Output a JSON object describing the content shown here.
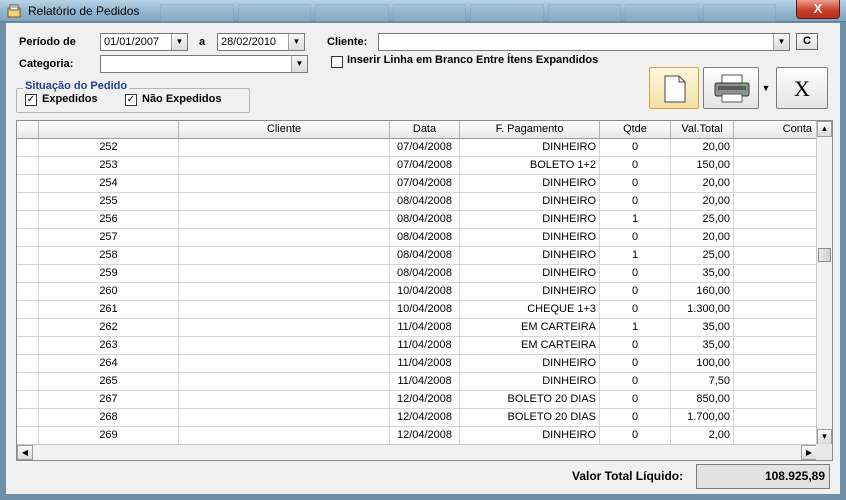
{
  "window": {
    "title": "Relatório de Pedidos",
    "close_label": "X"
  },
  "filters": {
    "periodo_label": "Período de",
    "date_from": "01/01/2007",
    "date_sep": "a",
    "date_to": "28/02/2010",
    "cliente_label": "Cliente:",
    "cliente_value": "",
    "clear_label": "C",
    "categoria_label": "Categoria:",
    "categoria_value": "",
    "blank_line_label": "Inserir Linha em Branco Entre Ítens Expandidos",
    "blank_line_checked": false
  },
  "situacao": {
    "title": "Situação do Pedido",
    "expedidos_label": "Expedidos",
    "expedidos_checked": true,
    "nao_expedidos_label": "Não Expedidos",
    "nao_expedidos_checked": true
  },
  "toolbar": {
    "close_report_label": "X"
  },
  "grid": {
    "columns": [
      "",
      "",
      "Cliente",
      "Data",
      "F. Pagamento",
      "Qtde",
      "Val.Total",
      "Conta"
    ],
    "rows": [
      [
        "252",
        "",
        "07/04/2008",
        "DINHEIRO",
        "0",
        "20,00"
      ],
      [
        "253",
        "",
        "07/04/2008",
        "BOLETO 1+2",
        "0",
        "150,00"
      ],
      [
        "254",
        "",
        "07/04/2008",
        "DINHEIRO",
        "0",
        "20,00"
      ],
      [
        "255",
        "",
        "08/04/2008",
        "DINHEIRO",
        "0",
        "20,00"
      ],
      [
        "256",
        "",
        "08/04/2008",
        "DINHEIRO",
        "1",
        "25,00"
      ],
      [
        "257",
        "",
        "08/04/2008",
        "DINHEIRO",
        "0",
        "20,00"
      ],
      [
        "258",
        "",
        "08/04/2008",
        "DINHEIRO",
        "1",
        "25,00"
      ],
      [
        "259",
        "",
        "08/04/2008",
        "DINHEIRO",
        "0",
        "35,00"
      ],
      [
        "260",
        "",
        "10/04/2008",
        "DINHEIRO",
        "0",
        "160,00"
      ],
      [
        "261",
        "",
        "10/04/2008",
        "CHEQUE 1+3",
        "0",
        "1.300,00"
      ],
      [
        "262",
        "",
        "11/04/2008",
        "EM CARTEIRA",
        "1",
        "35,00"
      ],
      [
        "263",
        "",
        "11/04/2008",
        "EM CARTEIRA",
        "0",
        "35,00"
      ],
      [
        "264",
        "",
        "11/04/2008",
        "DINHEIRO",
        "0",
        "100,00"
      ],
      [
        "265",
        "",
        "11/04/2008",
        "DINHEIRO",
        "0",
        "7,50"
      ],
      [
        "267",
        "",
        "12/04/2008",
        "BOLETO 20 DIAS",
        "0",
        "850,00"
      ],
      [
        "268",
        "",
        "12/04/2008",
        "BOLETO 20 DIAS",
        "0",
        "1.700,00"
      ],
      [
        "269",
        "",
        "12/04/2008",
        "DINHEIRO",
        "0",
        "2,00"
      ]
    ]
  },
  "footer": {
    "total_label": "Valor Total Líquido:",
    "total_value": "108.925,89"
  }
}
